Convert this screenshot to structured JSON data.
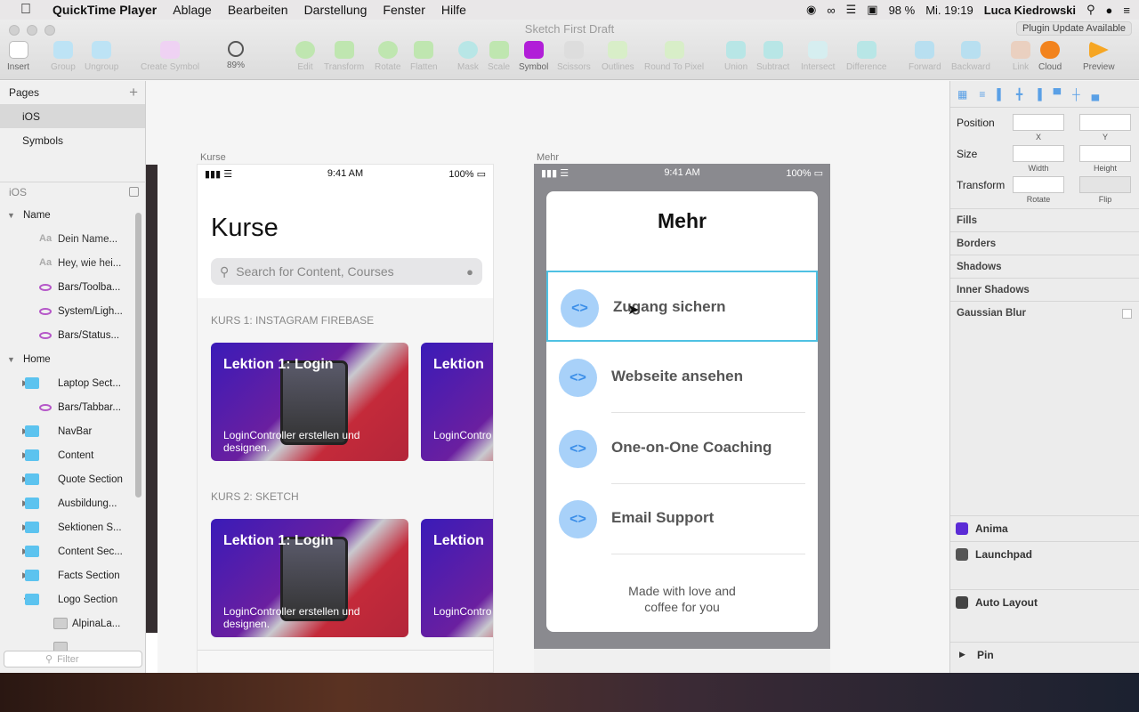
{
  "menubar": {
    "apple": "",
    "app": "QuickTime Player",
    "items": [
      "Ablage",
      "Bearbeiten",
      "Darstellung",
      "Fenster",
      "Hilfe"
    ],
    "battery": "98 %",
    "clock": "Mi. 19:19",
    "user": "Luca Kiedrowski"
  },
  "window": {
    "doc_title": "Sketch First Draft",
    "plugin_notice": "Plugin Update Available",
    "zoom": "89%"
  },
  "toolbar": {
    "insert": "Insert",
    "group": "Group",
    "ungroup": "Ungroup",
    "create_symbol": "Create Symbol",
    "edit": "Edit",
    "transform": "Transform",
    "rotate": "Rotate",
    "flatten": "Flatten",
    "mask": "Mask",
    "scale": "Scale",
    "symbol": "Symbol",
    "scissors": "Scissors",
    "outlines": "Outlines",
    "round": "Round To Pixel",
    "union": "Union",
    "subtract": "Subtract",
    "intersect": "Intersect",
    "difference": "Difference",
    "forward": "Forward",
    "backward": "Backward",
    "link": "Link",
    "cloud": "Cloud",
    "preview": "Preview"
  },
  "pages": {
    "header": "Pages",
    "items": [
      "iOS",
      "Symbols"
    ]
  },
  "layers": {
    "section": "iOS",
    "filter_placeholder": "Filter",
    "items": [
      {
        "label": "Name",
        "type": "group"
      },
      {
        "label": "Dein Name...",
        "type": "text"
      },
      {
        "label": "Hey, wie hei...",
        "type": "text"
      },
      {
        "label": "Bars/Toolba...",
        "type": "symbol"
      },
      {
        "label": "System/Ligh...",
        "type": "symbol"
      },
      {
        "label": "Bars/Status...",
        "type": "symbol"
      },
      {
        "label": "Home",
        "type": "group"
      },
      {
        "label": "Laptop Sect...",
        "type": "folder"
      },
      {
        "label": "Bars/Tabbar...",
        "type": "symbol"
      },
      {
        "label": "NavBar",
        "type": "folder"
      },
      {
        "label": "Content",
        "type": "folder"
      },
      {
        "label": "Quote Section",
        "type": "folder"
      },
      {
        "label": "Ausbildung...",
        "type": "folder"
      },
      {
        "label": "Sektionen S...",
        "type": "folder"
      },
      {
        "label": "Content Sec...",
        "type": "folder"
      },
      {
        "label": "Facts Section",
        "type": "folder"
      },
      {
        "label": "Logo Section",
        "type": "folder"
      },
      {
        "label": "AlpinaLa...",
        "type": "image"
      },
      {
        "label": "",
        "type": "image"
      }
    ]
  },
  "artboard_kurse": {
    "label": "Kurse",
    "time": "9:41 AM",
    "battery": "100%",
    "title": "Kurse",
    "search_placeholder": "Search for Content, Courses",
    "kurs1": "KURS 1: INSTAGRAM FIREBASE",
    "kurs2": "KURS 2: SKETCH",
    "card_title": "Lektion 1: Login",
    "card_sub": "LoginController erstellen und designen.",
    "card2_title": "Lektion",
    "card2_sub": "LoginContro designen."
  },
  "artboard_mehr": {
    "label": "Mehr",
    "time": "9:41 AM",
    "battery": "100%",
    "title": "Mehr",
    "rows": [
      "Zugang sichern",
      "Webseite ansehen",
      "One-on-One Coaching",
      "Email Support"
    ],
    "row_icon": "<>",
    "footer": "Made with love and coffee for you"
  },
  "inspector": {
    "position": "Position",
    "x": "X",
    "y": "Y",
    "size": "Size",
    "width": "Width",
    "height": "Height",
    "transform": "Transform",
    "rotate": "Rotate",
    "flip": "Flip",
    "fills": "Fills",
    "borders": "Borders",
    "shadows": "Shadows",
    "inner_shadows": "Inner Shadows",
    "blur": "Gaussian Blur",
    "anima": "Anima",
    "launchpad": "Launchpad",
    "auto_layout": "Auto Layout",
    "pin": "Pin"
  },
  "colors": {
    "accent": "#4fc1e3",
    "folder": "#5cc3ef",
    "symbol": "#b556c8",
    "row_icon_bg": "#a8d1f9"
  }
}
